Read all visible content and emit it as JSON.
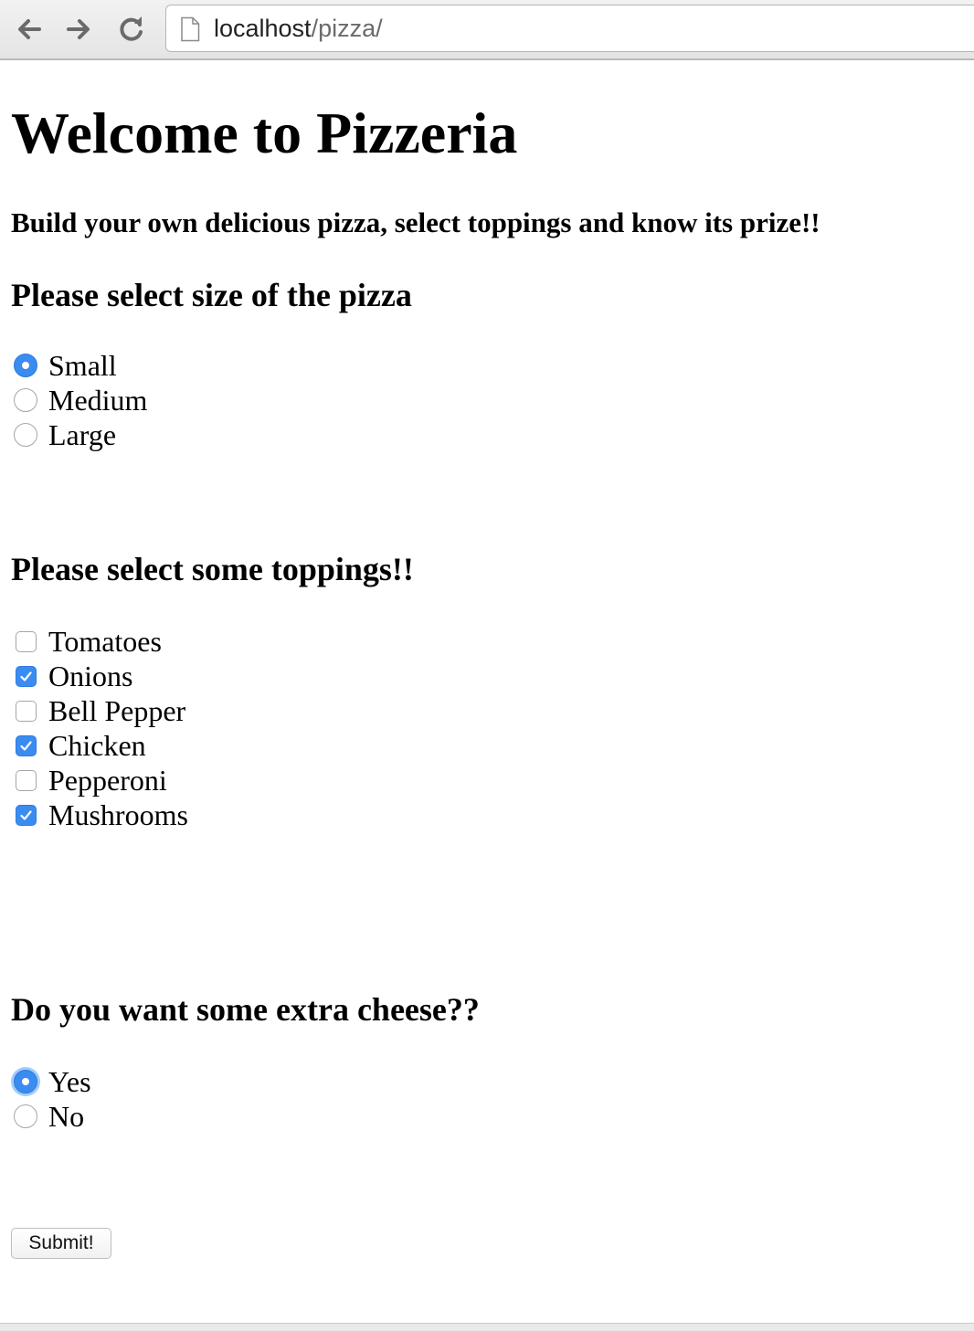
{
  "browser": {
    "url_host": "localhost",
    "url_path": "/pizza/"
  },
  "page": {
    "title": "Welcome to Pizzeria",
    "subtitle": "Build your own delicious pizza, select toppings and know its prize!!",
    "size_question": "Please select size of the pizza",
    "sizes": [
      {
        "label": "Small",
        "checked": true
      },
      {
        "label": "Medium",
        "checked": false
      },
      {
        "label": "Large",
        "checked": false
      }
    ],
    "toppings_question": "Please select some toppings!!",
    "toppings": [
      {
        "label": "Tomatoes",
        "checked": false
      },
      {
        "label": "Onions",
        "checked": true
      },
      {
        "label": "Bell Pepper",
        "checked": false
      },
      {
        "label": "Chicken",
        "checked": true
      },
      {
        "label": "Pepperoni",
        "checked": false
      },
      {
        "label": "Mushrooms",
        "checked": true
      }
    ],
    "cheese_question": "Do you want some extra cheese??",
    "cheese_options": [
      {
        "label": "Yes",
        "checked": true
      },
      {
        "label": "No",
        "checked": false
      }
    ],
    "submit_label": "Submit!"
  },
  "icons": {
    "back": "back-arrow-icon",
    "forward": "forward-arrow-icon",
    "reload": "reload-icon",
    "page": "page-icon",
    "check": "checkmark-icon"
  },
  "colors": {
    "accent": "#3a8cf0"
  }
}
